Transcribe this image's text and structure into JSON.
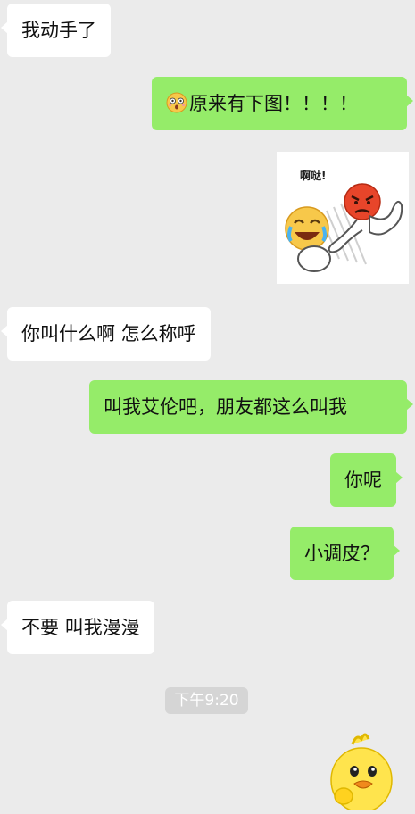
{
  "messages": [
    {
      "side": "left",
      "text": "我动手了"
    },
    {
      "side": "right",
      "text": "原来有下图！！！！",
      "emoji": "surprised-face"
    },
    {
      "side": "right",
      "type": "sticker",
      "sticker_text": "啊哒!",
      "sticker": "angry-face-kicking-laughing-face"
    },
    {
      "side": "left",
      "text": "你叫什么啊  怎么称呼"
    },
    {
      "side": "right",
      "text": "叫我艾伦吧，朋友都这么叫我"
    },
    {
      "side": "right",
      "text": "你呢"
    },
    {
      "side": "right",
      "text": "小调皮？"
    },
    {
      "side": "left",
      "text": "不要   叫我漫漫"
    }
  ],
  "timestamp": "下午9:20",
  "bottom_sticker": "yellow-duck-thinking",
  "colors": {
    "background": "#ebebeb",
    "sent_bubble": "#95ec69",
    "received_bubble": "#ffffff",
    "timestamp_bg": "#d5d5d5"
  }
}
